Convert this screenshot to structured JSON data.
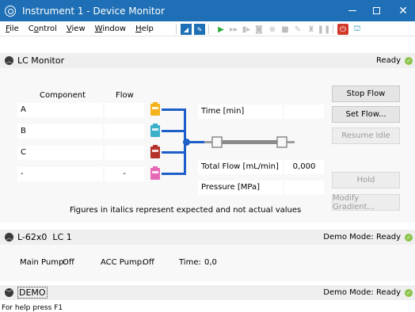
{
  "window": {
    "title": "Instrument 1 - Device Monitor",
    "close_glyph": "✕"
  },
  "menu": [
    {
      "pre": "",
      "u": "F",
      "post": "ile"
    },
    {
      "pre": "C",
      "u": "o",
      "post": "ntrol"
    },
    {
      "pre": "",
      "u": "V",
      "post": "iew"
    },
    {
      "pre": "",
      "u": "W",
      "post": "indow"
    },
    {
      "pre": "",
      "u": "H",
      "post": "elp"
    }
  ],
  "lc_monitor": {
    "title": "LC Monitor",
    "status": "Ready",
    "col_component": "Component",
    "col_flow": "Flow",
    "components": [
      {
        "name": "A",
        "flow": "",
        "color": "#f2b31d"
      },
      {
        "name": "B",
        "flow": "",
        "color": "#3ab0c9"
      },
      {
        "name": "C",
        "flow": "",
        "color": "#b5312b"
      },
      {
        "name": "-",
        "flow": "-",
        "color": "#e56ab5"
      }
    ],
    "time_label": "Time [min]",
    "time_value": "",
    "total_flow_label": "Total Flow [mL/min]",
    "total_flow_value": "0,000",
    "pressure_label": "Pressure [MPa]",
    "pressure_value": "",
    "buttons": {
      "stop_flow": "Stop Flow",
      "set_flow": "Set Flow...",
      "resume_idle": "Resume Idle",
      "hold": "Hold",
      "modify_gradient": "Modify Gradient..."
    },
    "note": "Figures in italics represent expected and not actual values"
  },
  "lc1": {
    "title": "L-62x0  LC 1",
    "status": "Demo Mode: Ready",
    "main_pump_label": "Main Pump:",
    "main_pump_value": "Off",
    "acc_pump_label": "ACC Pump:",
    "acc_pump_value": "Off",
    "time_label": "Time:",
    "time_value": "0,0"
  },
  "demo": {
    "title": "DEMO",
    "status": "Demo Mode: Ready"
  },
  "statusbar": {
    "text": "For help press F1"
  },
  "colors": {
    "titlebar": "#1e6fb5",
    "pipe": "#1e5ec8",
    "ready_green": "#8bc34a"
  }
}
